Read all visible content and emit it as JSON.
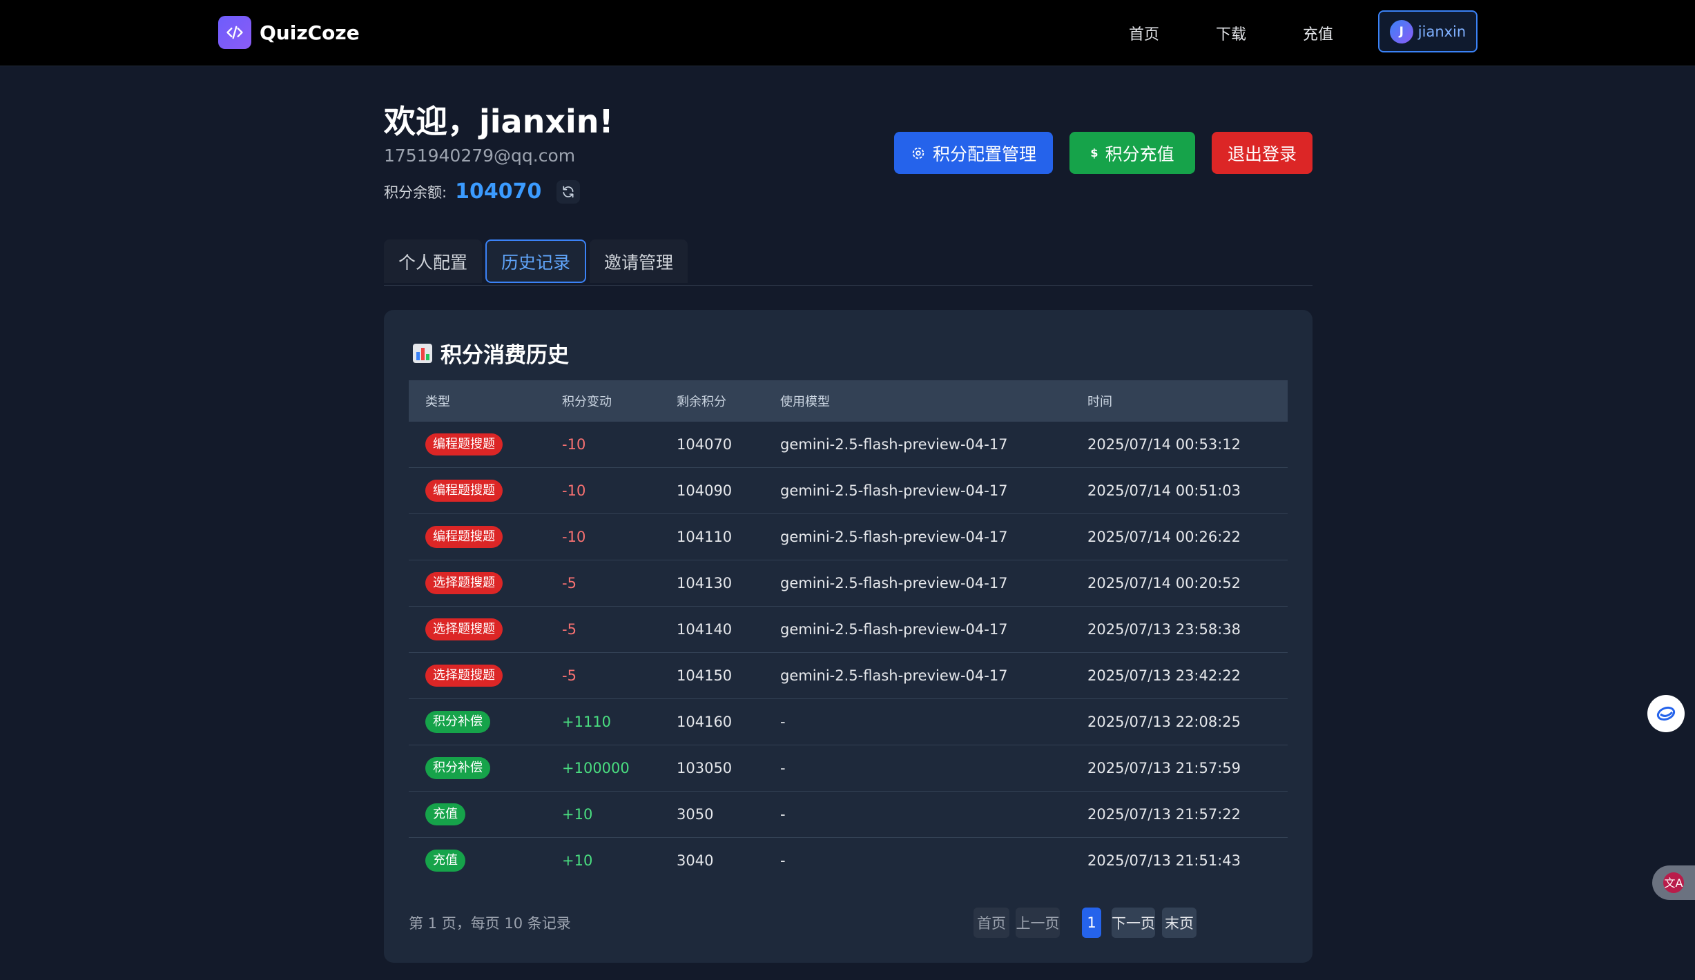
{
  "nav": {
    "brand": "QuizCoze",
    "links": [
      "首页",
      "下载",
      "充值"
    ],
    "user": {
      "initial": "J",
      "name": "jianxin"
    }
  },
  "header": {
    "welcome": "欢迎，jianxin!",
    "email": "1751940279@qq.com",
    "balance_label": "积分余额:",
    "balance_value": "104070"
  },
  "actions": {
    "config": "积分配置管理",
    "recharge": "积分充值",
    "logout": "退出登录"
  },
  "tabs": [
    "个人配置",
    "历史记录",
    "邀请管理"
  ],
  "active_tab": "历史记录",
  "history": {
    "title": "积分消费历史",
    "columns": [
      "类型",
      "积分变动",
      "剩余积分",
      "使用模型",
      "时间"
    ],
    "rows": [
      {
        "type": "编程题搜题",
        "type_color": "#dc2626",
        "change": "-10",
        "remain": "104070",
        "model": "gemini-2.5-flash-preview-04-17",
        "time": "2025/07/14 00:53:12"
      },
      {
        "type": "编程题搜题",
        "type_color": "#dc2626",
        "change": "-10",
        "remain": "104090",
        "model": "gemini-2.5-flash-preview-04-17",
        "time": "2025/07/14 00:51:03"
      },
      {
        "type": "编程题搜题",
        "type_color": "#dc2626",
        "change": "-10",
        "remain": "104110",
        "model": "gemini-2.5-flash-preview-04-17",
        "time": "2025/07/14 00:26:22"
      },
      {
        "type": "选择题搜题",
        "type_color": "#dc2626",
        "change": "-5",
        "remain": "104130",
        "model": "gemini-2.5-flash-preview-04-17",
        "time": "2025/07/14 00:20:52"
      },
      {
        "type": "选择题搜题",
        "type_color": "#dc2626",
        "change": "-5",
        "remain": "104140",
        "model": "gemini-2.5-flash-preview-04-17",
        "time": "2025/07/13 23:58:38"
      },
      {
        "type": "选择题搜题",
        "type_color": "#dc2626",
        "change": "-5",
        "remain": "104150",
        "model": "gemini-2.5-flash-preview-04-17",
        "time": "2025/07/13 23:42:22"
      },
      {
        "type": "积分补偿",
        "type_color": "#16a34a",
        "change": "+1110",
        "remain": "104160",
        "model": "-",
        "time": "2025/07/13 22:08:25"
      },
      {
        "type": "积分补偿",
        "type_color": "#16a34a",
        "change": "+100000",
        "remain": "103050",
        "model": "-",
        "time": "2025/07/13 21:57:59"
      },
      {
        "type": "充值",
        "type_color": "#16a34a",
        "change": "+10",
        "remain": "3050",
        "model": "-",
        "time": "2025/07/13 21:57:22"
      },
      {
        "type": "充值",
        "type_color": "#16a34a",
        "change": "+10",
        "remain": "3040",
        "model": "-",
        "time": "2025/07/13 21:51:43"
      }
    ]
  },
  "pagination": {
    "info": "第 1 页，每页 10 条记录",
    "first": "首页",
    "prev": "上一页",
    "current": "1",
    "next": "下一页",
    "last": "末页"
  },
  "colors": {
    "accent": "#3b82f6",
    "danger": "#dc2626",
    "success": "#16a34a"
  }
}
